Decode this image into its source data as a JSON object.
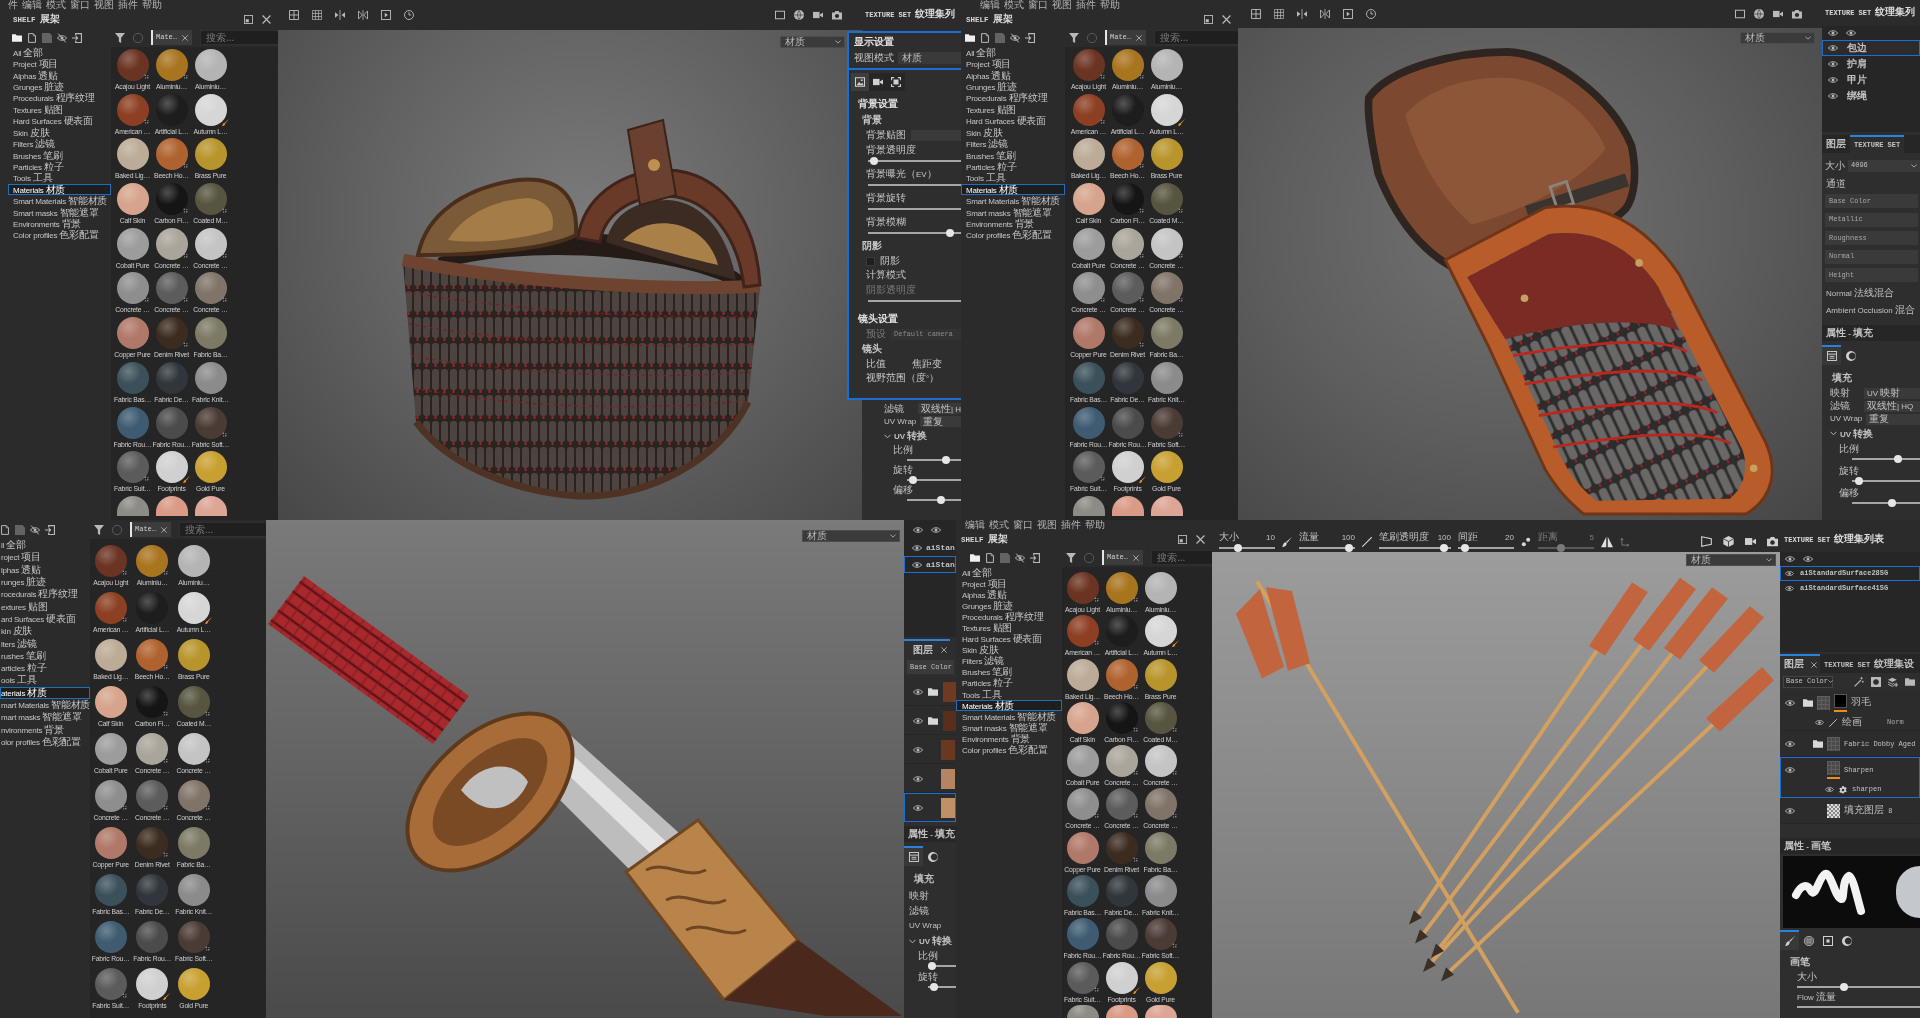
{
  "top_left": {
    "menu": [
      "件",
      "编辑",
      "模式",
      "窗口",
      "视图",
      "插件",
      "帮助"
    ],
    "shelf": {
      "title": "SHELF 展架",
      "filter_tag": "Mate…",
      "search": {
        "placeholder": "搜索..."
      },
      "categories": [
        {
          "label": "All 全部",
          "selected": false
        },
        {
          "label": "Project 项目",
          "selected": false
        },
        {
          "label": "Alphas 透贴",
          "selected": false
        },
        {
          "label": "Grunges 脏迹",
          "selected": false
        },
        {
          "label": "Procedurals 程序纹理",
          "selected": false
        },
        {
          "label": "Textures 贴图",
          "selected": false
        },
        {
          "label": "Hard Surfaces 硬表面",
          "selected": false
        },
        {
          "label": "Skin 皮肤",
          "selected": false
        },
        {
          "label": "Filters 滤镜",
          "selected": false
        },
        {
          "label": "Brushes 笔刷",
          "selected": false
        },
        {
          "label": "Particles 粒子",
          "selected": false
        },
        {
          "label": "Tools 工具",
          "selected": false
        },
        {
          "label": "Materials 材质",
          "selected": true
        },
        {
          "label": "Smart Materials 智能材质",
          "selected": false
        },
        {
          "label": "Smart masks 智能遮罩",
          "selected": false
        },
        {
          "label": "Environments 背景",
          "selected": false
        },
        {
          "label": "Color profiles 色彩配置",
          "selected": false
        }
      ],
      "materials": [
        {
          "name": "Acajou Light",
          "color": "#6b3322",
          "kind": "procedural"
        },
        {
          "name": "Aluminiu…",
          "color": "#a8741e",
          "kind": "procedural"
        },
        {
          "name": "Aluminiu…",
          "color": "#b4b4b4",
          "kind": "plain"
        },
        {
          "name": "American …",
          "color": "#8c3f22",
          "kind": "procedural"
        },
        {
          "name": "Artificial L…",
          "color": "#1d1d1d",
          "kind": "plain"
        },
        {
          "name": "Autumn L…",
          "color": "#d6d6d6",
          "kind": "painted"
        },
        {
          "name": "Baked Lig…",
          "color": "#bcab96",
          "kind": "plain"
        },
        {
          "name": "Beech Ho…",
          "color": "#b0622e",
          "kind": "procedural"
        },
        {
          "name": "Brass Pure",
          "color": "#b8952c",
          "kind": "plain"
        },
        {
          "name": "Calf Skin",
          "color": "#d6a48c",
          "kind": "plain"
        },
        {
          "name": "Carbon Fi…",
          "color": "#151515",
          "kind": "procedural"
        },
        {
          "name": "Coated M…",
          "color": "#57553f",
          "kind": "procedural"
        },
        {
          "name": "Cobalt Pure",
          "color": "#9c9c9c",
          "kind": "plain"
        },
        {
          "name": "Concrete …",
          "color": "#aaa59b",
          "kind": "procedural"
        },
        {
          "name": "Concrete …",
          "color": "#c4c4c4",
          "kind": "procedural"
        },
        {
          "name": "Concrete …",
          "color": "#8e8e8e",
          "kind": "procedural"
        },
        {
          "name": "Concrete …",
          "color": "#5c5c5c",
          "kind": "procedural"
        },
        {
          "name": "Concrete …",
          "color": "#807468",
          "kind": "procedural"
        },
        {
          "name": "Copper Pure",
          "color": "#b07868",
          "kind": "plain"
        },
        {
          "name": "Denim Rivet",
          "color": "#3c2c20",
          "kind": "procedural"
        },
        {
          "name": "Fabric Ba…",
          "color": "#7c7a64",
          "kind": "plain"
        },
        {
          "name": "Fabric Bas…",
          "color": "#3b5159",
          "kind": "plain"
        },
        {
          "name": "Fabric De…",
          "color": "#30363b",
          "kind": "plain"
        },
        {
          "name": "Fabric Knit…",
          "color": "#8b8b8b",
          "kind": "plain"
        },
        {
          "name": "Fabric Rou…",
          "color": "#3e5b71",
          "kind": "plain"
        },
        {
          "name": "Fabric Rou…",
          "color": "#4b4b4b",
          "kind": "plain"
        },
        {
          "name": "Fabric Soft…",
          "color": "#4b3b35",
          "kind": "procedural"
        },
        {
          "name": "Fabric Suit…",
          "color": "#5b5b5b",
          "kind": "procedural"
        },
        {
          "name": "Footprints",
          "color": "#d0d0d0",
          "kind": "painted"
        },
        {
          "name": "Gold Pure",
          "color": "#c8a032",
          "kind": "plain"
        },
        {
          "color": "#8d8b85",
          "kind": "plain"
        },
        {
          "color": "#d99b85",
          "kind": "plain"
        },
        {
          "color": "#dca595",
          "kind": "plain"
        }
      ]
    },
    "viewport": {
      "kind": "armor",
      "view_mode": "材质"
    },
    "texture_set": {
      "title": "TEXTURE SET 纹理集列"
    },
    "display_settings": {
      "title": "显示设置",
      "view_mode": {
        "label": "视图模式",
        "value": "材质"
      },
      "tabs": [
        {
          "kind": "image",
          "selected": true
        },
        {
          "kind": "video",
          "selected": false
        },
        {
          "kind": "frame",
          "selected": false
        }
      ],
      "sections": [
        {
          "title": "背景设置",
          "rows": [
            {
              "kind": "heading",
              "label": "背景",
              "disabled": false
            },
            {
              "kind": "field",
              "label": "背景贴图",
              "disabled": false
            },
            {
              "kind": "slider",
              "label": "背景透明度",
              "level": 0.02,
              "disabled": false
            },
            {
              "kind": "track",
              "label": "背景曝光（EV）",
              "disabled": false
            },
            {
              "kind": "track",
              "label": "背景旋转",
              "disabled": false
            },
            {
              "kind": "slider",
              "label": "背景模糊",
              "level": 0.92,
              "disabled": false
            },
            {
              "kind": "heading",
              "label": "阴影",
              "disabled": false
            },
            {
              "kind": "checkbox",
              "label": "阴影",
              "checked": false,
              "disabled": false
            },
            {
              "kind": "text",
              "label": "计算模式",
              "disabled": false
            },
            {
              "kind": "track",
              "label": "阴影透明度",
              "disabled": true
            }
          ]
        },
        {
          "title": "镜头设置",
          "rows": [
            {
              "kind": "field",
              "label": "预设",
              "value": "Default camera",
              "disabled": true
            },
            {
              "kind": "heading",
              "label": "镜头",
              "disabled": false
            },
            {
              "kind": "pair",
              "label": "比值",
              "value": "焦距变",
              "disabled": false
            },
            {
              "kind": "text",
              "label": "视野范围（度°）",
              "disabled": false
            }
          ]
        }
      ]
    },
    "properties": {
      "rows": [
        {
          "kind": "field",
          "label": "滤镜",
          "value": "双线性| H"
        },
        {
          "kind": "field",
          "label": "UV Wrap",
          "value": "重复"
        },
        {
          "kind": "group",
          "label": "UV 转换",
          "expanded": true
        },
        {
          "kind": "slider",
          "label": "比例",
          "level": 0.75
        },
        {
          "kind": "slider",
          "label": "旋转",
          "level": 0.05
        },
        {
          "kind": "slider",
          "label": "偏移",
          "level": 0.65
        }
      ]
    }
  },
  "top_right": {
    "menu": [
      "编辑",
      "模式",
      "窗口",
      "视图",
      "插件",
      "帮助"
    ],
    "shelf": {
      "title": "SHELF 展架",
      "filter_tag": "Mate…",
      "search": {
        "placeholder": "搜索..."
      },
      "categories": [
        {
          "label": "All 全部",
          "selected": false
        },
        {
          "label": "Project 项目",
          "selected": false
        },
        {
          "label": "Alphas 透贴",
          "selected": false
        },
        {
          "label": "Grunges 脏迹",
          "selected": false
        },
        {
          "label": "Procedurals 程序纹理",
          "selected": false
        },
        {
          "label": "Textures 贴图",
          "selected": false
        },
        {
          "label": "Hard Surfaces 硬表面",
          "selected": false
        },
        {
          "label": "Skin 皮肤",
          "selected": false
        },
        {
          "label": "Filters 滤镜",
          "selected": false
        },
        {
          "label": "Brushes 笔刷",
          "selected": false
        },
        {
          "label": "Particles 粒子",
          "selected": false
        },
        {
          "label": "Tools 工具",
          "selected": false
        },
        {
          "label": "Materials 材质",
          "selected": true
        },
        {
          "label": "Smart Materials 智能材质",
          "selected": false
        },
        {
          "label": "Smart masks 智能遮罩",
          "selected": false
        },
        {
          "label": "Environments 背景",
          "selected": false
        },
        {
          "label": "Color profiles 色彩配置",
          "selected": false
        }
      ],
      "materials": [
        {
          "name": "Acajou Light",
          "color": "#6b3322",
          "kind": "procedural"
        },
        {
          "name": "Aluminiu…",
          "color": "#a8741e",
          "kind": "procedural"
        },
        {
          "name": "Aluminiu…",
          "color": "#b4b4b4",
          "kind": "plain"
        },
        {
          "name": "American …",
          "color": "#8c3f22",
          "kind": "procedural"
        },
        {
          "name": "Artificial L…",
          "color": "#1d1d1d",
          "kind": "plain"
        },
        {
          "name": "Autumn L…",
          "color": "#d6d6d6",
          "kind": "painted"
        },
        {
          "name": "Baked Lig…",
          "color": "#bcab96",
          "kind": "plain"
        },
        {
          "name": "Beech Ho…",
          "color": "#b0622e",
          "kind": "procedural"
        },
        {
          "name": "Brass Pure",
          "color": "#b8952c",
          "kind": "plain"
        },
        {
          "name": "Calf Skin",
          "color": "#d6a48c",
          "kind": "plain"
        },
        {
          "name": "Carbon Fi…",
          "color": "#151515",
          "kind": "procedural"
        },
        {
          "name": "Coated M…",
          "color": "#57553f",
          "kind": "procedural"
        },
        {
          "name": "Cobalt Pure",
          "color": "#9c9c9c",
          "kind": "plain"
        },
        {
          "name": "Concrete …",
          "color": "#aaa59b",
          "kind": "procedural"
        },
        {
          "name": "Concrete …",
          "color": "#c4c4c4",
          "kind": "procedural"
        },
        {
          "name": "Concrete …",
          "color": "#8e8e8e",
          "kind": "procedural"
        },
        {
          "name": "Concrete …",
          "color": "#5c5c5c",
          "kind": "procedural"
        },
        {
          "name": "Concrete …",
          "color": "#807468",
          "kind": "procedural"
        },
        {
          "name": "Copper Pure",
          "color": "#b07868",
          "kind": "plain"
        },
        {
          "name": "Denim Rivet",
          "color": "#3c2c20",
          "kind": "procedural"
        },
        {
          "name": "Fabric Ba…",
          "color": "#7c7a64",
          "kind": "plain"
        },
        {
          "name": "Fabric Bas…",
          "color": "#3b5159",
          "kind": "plain"
        },
        {
          "name": "Fabric De…",
          "color": "#30363b",
          "kind": "plain"
        },
        {
          "name": "Fabric Knit…",
          "color": "#8b8b8b",
          "kind": "plain"
        },
        {
          "name": "Fabric Rou…",
          "color": "#3e5b71",
          "kind": "plain"
        },
        {
          "name": "Fabric Rou…",
          "color": "#4b4b4b",
          "kind": "plain"
        },
        {
          "name": "Fabric Soft…",
          "color": "#4b3b35",
          "kind": "procedural"
        },
        {
          "name": "Fabric Suit…",
          "color": "#5b5b5b",
          "kind": "procedural"
        },
        {
          "name": "Footprints",
          "color": "#d0d0d0",
          "kind": "painted"
        },
        {
          "name": "Gold Pure",
          "color": "#c8a032",
          "kind": "plain"
        },
        {
          "color": "#8d8b85",
          "kind": "plain"
        },
        {
          "color": "#d99b85",
          "kind": "plain"
        },
        {
          "color": "#dca595",
          "kind": "plain"
        }
      ]
    },
    "viewport": {
      "kind": "shoulder_armor",
      "view_mode": "材质"
    },
    "texture_set": {
      "title": "TEXTURE SET 纹理集列",
      "sets": [
        {
          "label": "包边",
          "selected": true
        },
        {
          "label": "护肩",
          "selected": false
        },
        {
          "label": "甲片",
          "selected": false
        },
        {
          "label": "绑绳",
          "selected": false
        }
      ]
    },
    "tabs": [
      {
        "label": "图层",
        "selected": false
      },
      {
        "label": "TEXTURE SET",
        "selected": true
      }
    ],
    "texture_settings": {
      "size": {
        "label": "大小",
        "value": "4096"
      },
      "channels_title": "通道",
      "channels": [
        "Base Color",
        "Metallic",
        "Roughness",
        "Normal",
        "Height"
      ],
      "blend": [
        "Normal 法线混合",
        "Ambient Occlusion 混合"
      ]
    },
    "properties": {
      "title": "属性 - 填充",
      "tabs": [
        {
          "kind": "list",
          "selected": true
        },
        {
          "kind": "sphere",
          "selected": false
        }
      ],
      "section": "填充",
      "rows": [
        {
          "kind": "field",
          "label": "映射",
          "value": "UV 映射"
        },
        {
          "kind": "field",
          "label": "滤镜",
          "value": "双线性| HQ"
        },
        {
          "kind": "field",
          "label": "UV Wrap",
          "value": "重复"
        },
        {
          "kind": "group",
          "label": "UV 转换",
          "expanded": true
        },
        {
          "kind": "slider",
          "label": "比例",
          "level": 0.7
        },
        {
          "kind": "slider",
          "label": "旋转",
          "level": 0.05
        },
        {
          "kind": "slider",
          "label": "偏移",
          "level": 0.6
        }
      ]
    }
  },
  "bottom_left": {
    "shelf": {
      "filter_tag": "Mate…",
      "search": {
        "placeholder": "搜索..."
      },
      "categories": [
        {
          "label": "ll 全部",
          "selected": false
        },
        {
          "label": "roject 项目",
          "selected": false
        },
        {
          "label": "lphas 透贴",
          "selected": false
        },
        {
          "label": "runges 脏迹",
          "selected": false
        },
        {
          "label": "rocedurals 程序纹理",
          "selected": false
        },
        {
          "label": "extures 贴图",
          "selected": false
        },
        {
          "label": "ard Surfaces 硬表面",
          "selected": false
        },
        {
          "label": "kin 皮肤",
          "selected": false
        },
        {
          "label": "lters 滤镜",
          "selected": false
        },
        {
          "label": "rushes 笔刷",
          "selected": false
        },
        {
          "label": "articles 粒子",
          "selected": false
        },
        {
          "label": "ools 工具",
          "selected": false
        },
        {
          "label": "aterials 材质",
          "selected": true
        },
        {
          "label": "mart Materials 智能材质",
          "selected": false
        },
        {
          "label": "mart masks 智能遮罩",
          "selected": false
        },
        {
          "label": "nvironments 背景",
          "selected": false
        },
        {
          "label": "olor profiles 色彩配置",
          "selected": false
        }
      ],
      "materials": [
        {
          "name": "Acajou Light",
          "color": "#6b3322",
          "kind": "procedural"
        },
        {
          "name": "Aluminiu…",
          "color": "#a8741e",
          "kind": "procedural"
        },
        {
          "name": "Aluminiu…",
          "color": "#b4b4b4",
          "kind": "plain"
        },
        {
          "name": "American …",
          "color": "#8c3f22",
          "kind": "procedural"
        },
        {
          "name": "Artificial L…",
          "color": "#1d1d1d",
          "kind": "plain"
        },
        {
          "name": "Autumn L…",
          "color": "#d6d6d6",
          "kind": "painted"
        },
        {
          "name": "Baked Lig…",
          "color": "#bcab96",
          "kind": "plain"
        },
        {
          "name": "Beech Ho…",
          "color": "#b0622e",
          "kind": "procedural"
        },
        {
          "name": "Brass Pure",
          "color": "#b8952c",
          "kind": "plain"
        },
        {
          "name": "Calf Skin",
          "color": "#d6a48c",
          "kind": "plain"
        },
        {
          "name": "Carbon Fi…",
          "color": "#151515",
          "kind": "procedural"
        },
        {
          "name": "Coated M…",
          "color": "#57553f",
          "kind": "procedural"
        },
        {
          "name": "Cobalt Pure",
          "color": "#9c9c9c",
          "kind": "plain"
        },
        {
          "name": "Concrete …",
          "color": "#aaa59b",
          "kind": "procedural"
        },
        {
          "name": "Concrete …",
          "color": "#c4c4c4",
          "kind": "procedural"
        },
        {
          "name": "Concrete …",
          "color": "#8e8e8e",
          "kind": "procedural"
        },
        {
          "name": "Concrete …",
          "color": "#5c5c5c",
          "kind": "procedural"
        },
        {
          "name": "Concrete …",
          "color": "#807468",
          "kind": "procedural"
        },
        {
          "name": "Copper Pure",
          "color": "#b07868",
          "kind": "plain"
        },
        {
          "name": "Denim Rivet",
          "color": "#3c2c20",
          "kind": "procedural"
        },
        {
          "name": "Fabric Ba…",
          "color": "#7c7a64",
          "kind": "plain"
        },
        {
          "name": "Fabric Bas…",
          "color": "#3b5159",
          "kind": "plain"
        },
        {
          "name": "Fabric De…",
          "color": "#30363b",
          "kind": "plain"
        },
        {
          "name": "Fabric Knit…",
          "color": "#8b8b8b",
          "kind": "plain"
        },
        {
          "name": "Fabric Rou…",
          "color": "#3e5b71",
          "kind": "plain"
        },
        {
          "name": "Fabric Rou…",
          "color": "#4b4b4b",
          "kind": "plain"
        },
        {
          "name": "Fabric Soft…",
          "color": "#4b3b35",
          "kind": "procedural"
        },
        {
          "name": "Fabric Suit…",
          "color": "#5b5b5b",
          "kind": "procedural"
        },
        {
          "name": "Footprints",
          "color": "#d0d0d0",
          "kind": "painted"
        },
        {
          "name": "Gold Pure",
          "color": "#c8a032",
          "kind": "plain"
        }
      ]
    },
    "viewport": {
      "kind": "sword",
      "view_mode": "材质"
    }
  },
  "bottom_right": {
    "layer_strip": {
      "sets": [
        {
          "label": "aiStan",
          "selected": false
        },
        {
          "label": "aiStan",
          "selected": true
        }
      ],
      "tab": {
        "label": "图层",
        "closable": true
      },
      "channel": "Base Color",
      "layers": [
        {
          "kind": "folder",
          "color": "#6e3a22",
          "selected": false
        },
        {
          "kind": "folder",
          "color": "#5a2e1c",
          "selected": false
        },
        {
          "kind": "fill",
          "color": "#6a381e",
          "selected": false
        },
        {
          "kind": "fill",
          "color": "#b58462",
          "selected": false
        },
        {
          "kind": "fill",
          "color": "#c09066",
          "selected": true
        }
      ],
      "properties": {
        "title": "属性 - 填充",
        "tabs": [
          {
            "kind": "list",
            "selected": true
          },
          {
            "kind": "sphere",
            "selected": false
          }
        ],
        "section": "填充",
        "rows": [
          {
            "kind": "text",
            "label": "映射"
          },
          {
            "kind": "text",
            "label": "滤镜"
          },
          {
            "kind": "text",
            "label": "UV Wrap"
          },
          {
            "kind": "group",
            "label": "UV 转换",
            "expanded": true
          },
          {
            "kind": "slider",
            "label": "比例",
            "level": 0.0
          },
          {
            "kind": "slider",
            "label": "旋转",
            "level": 0.1
          }
        ]
      }
    },
    "menu": [
      "编辑",
      "模式",
      "窗口",
      "视图",
      "插件",
      "帮助"
    ],
    "shelf": {
      "title": "SHELF 展架",
      "filter_tag": "Mate…",
      "search": {
        "placeholder": "搜索..."
      },
      "categories": [
        {
          "label": "All 全部",
          "selected": false
        },
        {
          "label": "Project 项目",
          "selected": false
        },
        {
          "label": "Alphas 透贴",
          "selected": false
        },
        {
          "label": "Grunges 脏迹",
          "selected": false
        },
        {
          "label": "Procedurals 程序纹理",
          "selected": false
        },
        {
          "label": "Textures 贴图",
          "selected": false
        },
        {
          "label": "Hard Surfaces 硬表面",
          "selected": false
        },
        {
          "label": "Skin 皮肤",
          "selected": false
        },
        {
          "label": "Filters 滤镜",
          "selected": false
        },
        {
          "label": "Brushes 笔刷",
          "selected": false
        },
        {
          "label": "Particles 粒子",
          "selected": false
        },
        {
          "label": "Tools 工具",
          "selected": false
        },
        {
          "label": "Materials 材质",
          "selected": true
        },
        {
          "label": "Smart Materials 智能材质",
          "selected": false
        },
        {
          "label": "Smart masks 智能遮罩",
          "selected": false
        },
        {
          "label": "Environments 背景",
          "selected": false
        },
        {
          "label": "Color profiles 色彩配置",
          "selected": false
        }
      ],
      "materials": [
        {
          "name": "Acajou Light",
          "color": "#6b3322",
          "kind": "procedural"
        },
        {
          "name": "Aluminiu…",
          "color": "#a8741e",
          "kind": "procedural"
        },
        {
          "name": "Aluminiu…",
          "color": "#b4b4b4",
          "kind": "plain"
        },
        {
          "name": "American …",
          "color": "#8c3f22",
          "kind": "procedural"
        },
        {
          "name": "Artificial L…",
          "color": "#1d1d1d",
          "kind": "plain"
        },
        {
          "name": "Autumn L…",
          "color": "#d6d6d6",
          "kind": "painted"
        },
        {
          "name": "Baked Lig…",
          "color": "#bcab96",
          "kind": "plain"
        },
        {
          "name": "Beech Ho…",
          "color": "#b0622e",
          "kind": "procedural"
        },
        {
          "name": "Brass Pure",
          "color": "#b8952c",
          "kind": "plain"
        },
        {
          "name": "Calf Skin",
          "color": "#d6a48c",
          "kind": "plain"
        },
        {
          "name": "Carbon Fi…",
          "color": "#151515",
          "kind": "procedural"
        },
        {
          "name": "Coated M…",
          "color": "#57553f",
          "kind": "procedural"
        },
        {
          "name": "Cobalt Pure",
          "color": "#9c9c9c",
          "kind": "plain"
        },
        {
          "name": "Concrete …",
          "color": "#aaa59b",
          "kind": "procedural"
        },
        {
          "name": "Concrete …",
          "color": "#c4c4c4",
          "kind": "procedural"
        },
        {
          "name": "Concrete …",
          "color": "#8e8e8e",
          "kind": "procedural"
        },
        {
          "name": "Concrete …",
          "color": "#5c5c5c",
          "kind": "procedural"
        },
        {
          "name": "Concrete …",
          "color": "#807468",
          "kind": "procedural"
        },
        {
          "name": "Copper Pure",
          "color": "#b07868",
          "kind": "plain"
        },
        {
          "name": "Denim Rivet",
          "color": "#3c2c20",
          "kind": "procedural"
        },
        {
          "name": "Fabric Ba…",
          "color": "#7c7a64",
          "kind": "plain"
        },
        {
          "name": "Fabric Bas…",
          "color": "#3b5159",
          "kind": "plain"
        },
        {
          "name": "Fabric De…",
          "color": "#30363b",
          "kind": "plain"
        },
        {
          "name": "Fabric Knit…",
          "color": "#8b8b8b",
          "kind": "plain"
        },
        {
          "name": "Fabric Rou…",
          "color": "#3e5b71",
          "kind": "plain"
        },
        {
          "name": "Fabric Rou…",
          "color": "#4b4b4b",
          "kind": "plain"
        },
        {
          "name": "Fabric Soft…",
          "color": "#4b3b35",
          "kind": "procedural"
        },
        {
          "name": "Fabric Suit…",
          "color": "#5b5b5b",
          "kind": "procedural"
        },
        {
          "name": "Footprints",
          "color": "#d0d0d0",
          "kind": "painted"
        },
        {
          "name": "Gold Pure",
          "color": "#c8a032",
          "kind": "plain"
        },
        {
          "color": "#8d8b85",
          "kind": "plain"
        },
        {
          "color": "#d99b85",
          "kind": "plain"
        },
        {
          "color": "#dca595",
          "kind": "plain"
        }
      ]
    },
    "viewport": {
      "kind": "arrows",
      "view_mode": "材质",
      "brush_settings": [
        {
          "label": "大小",
          "value": "10",
          "level": 0.32,
          "disabled": false
        },
        {
          "label": "流量",
          "value": "100",
          "level": 0.95,
          "disabled": false
        },
        {
          "label": "笔刷透明度",
          "value": "100",
          "level": 0.95,
          "disabled": false
        },
        {
          "label": "间距",
          "value": "20",
          "level": 0.07,
          "disabled": false
        },
        {
          "label": "距离",
          "value": "5",
          "level": 0.4,
          "disabled": true
        }
      ]
    },
    "texture_set": {
      "title": "TEXTURE SET 纹理集列表",
      "sets": [
        {
          "label": "aiStandardSurface28SG",
          "selected": true
        },
        {
          "label": "aiStandardSurface41SG",
          "selected": false
        }
      ]
    },
    "tabs": [
      {
        "label": "图层",
        "closable": true,
        "selected": true
      },
      {
        "label": "TEXTURE SET 纹理集设",
        "closable": false,
        "selected": false
      }
    ],
    "channel": "Base Color",
    "layers": [
      {
        "kind": "folder",
        "label": "羽毛",
        "mask": true,
        "mask_targeted": true,
        "content_targeted": false,
        "selected": false,
        "effects": [
          {
            "kind": "paint",
            "label": "绘画",
            "blend": "Norm"
          }
        ],
        "children": [
          {
            "kind": "folder",
            "label": "Fabric Dobby Aged",
            "mask": false,
            "content_targeted": false,
            "selected": false
          },
          {
            "kind": "fill",
            "label": "Sharpen",
            "mask": false,
            "content_targeted": true,
            "selected": true,
            "effects": [
              {
                "kind": "filter",
                "label": "sharpen"
              }
            ]
          },
          {
            "kind": "empty_fill",
            "label": "填充图层 8",
            "mask": false,
            "content_targeted": false,
            "selected": false
          }
        ]
      }
    ],
    "brush_properties": {
      "title": "属性 - 画笔",
      "tabs": [
        {
          "kind": "brush",
          "selected": true
        },
        {
          "kind": "pattern",
          "selected": false
        },
        {
          "kind": "stencil",
          "selected": false
        },
        {
          "kind": "sphere",
          "selected": false
        }
      ],
      "section": "画笔",
      "rows": [
        {
          "kind": "slider",
          "label": "大小",
          "level": 0.37
        },
        {
          "kind": "track",
          "label": "Flow 流量"
        }
      ]
    }
  }
}
